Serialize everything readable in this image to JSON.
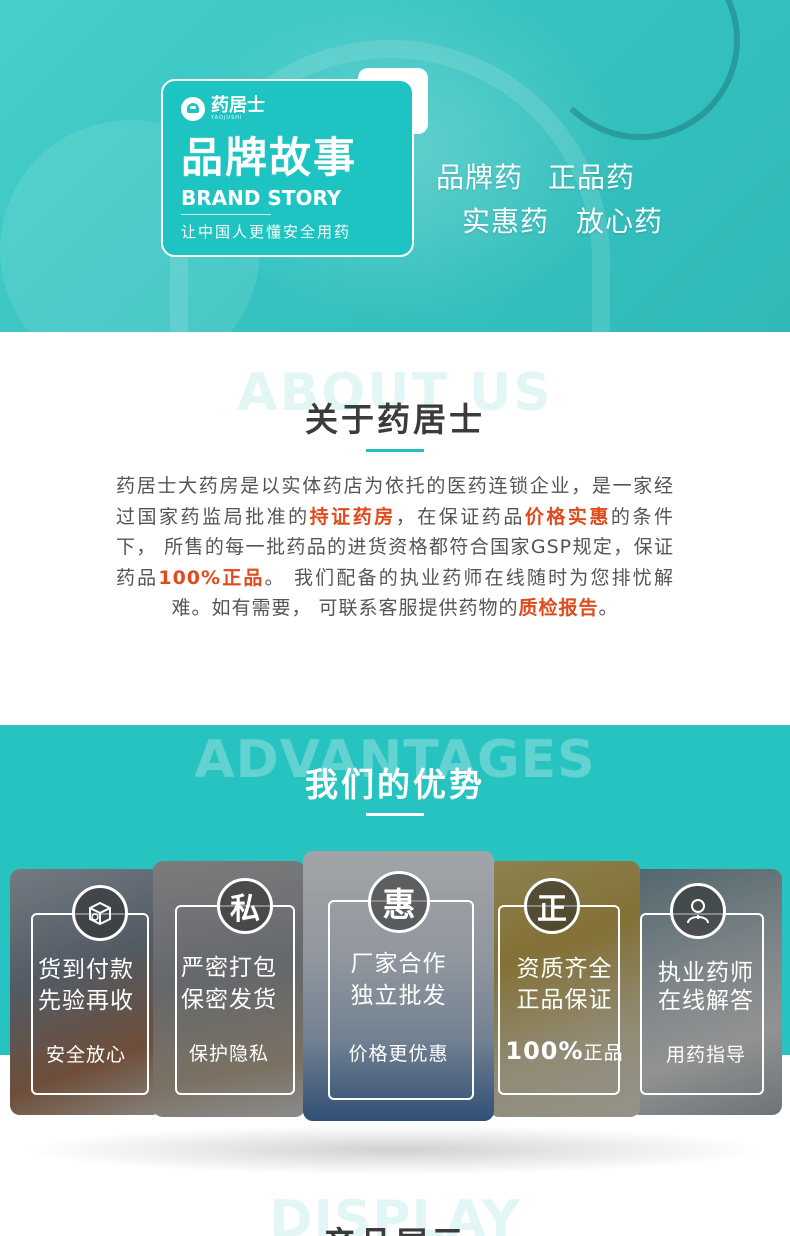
{
  "hero": {
    "logo_text": "药居士",
    "logo_en": "YAOJUSHI",
    "title_cn": "品牌故事",
    "title_en": "BRAND STORY",
    "slogan": "让中国人更懂安全用药",
    "keywords": [
      "品牌药",
      "正品药",
      "实惠药",
      "放心药"
    ]
  },
  "about": {
    "bg_text": "ABOUT US",
    "title": "关于药居士",
    "segments": [
      "药居士大药房是以实体药店为依托的医药连锁企业，是一家经过国家药监局批准的",
      "持证药房",
      "，在保证药品",
      "价格实惠",
      "的条件下， 所售的每一批药品的进货资格都符合国家GSP规定，保证药品",
      "100%正品",
      "。 我们配备的执业药师在线随时为您排忧解难。如有需要， 可联系客服提供药物的",
      "质检报告",
      "。"
    ]
  },
  "advantages": {
    "bg_text": "ADVANTAGES",
    "title": "我们的优势",
    "cards": [
      {
        "badge": "",
        "line1": "货到付款",
        "line2": "先验再收",
        "sub": "安全放心"
      },
      {
        "badge": "私",
        "line1": "严密打包",
        "line2": "保密发货",
        "sub": "保护隐私"
      },
      {
        "badge": "惠",
        "line1": "厂家合作",
        "line2": "独立批发",
        "sub": "价格更优惠"
      },
      {
        "badge": "正",
        "line1": "资质齐全",
        "line2": "正品保证",
        "sub_big": "100%",
        "sub_small": "正品"
      },
      {
        "badge": "",
        "line1": "执业药师",
        "line2": "在线解答",
        "sub": "用药指导"
      }
    ]
  },
  "display": {
    "bg_text": "DISPLAY",
    "title": "产品展示"
  },
  "colors": {
    "accent": "#24c0bd",
    "highlight": "#e04a1c",
    "text": "#555555"
  },
  "icons": [
    "box-money-icon",
    "pharmacist-icon"
  ]
}
